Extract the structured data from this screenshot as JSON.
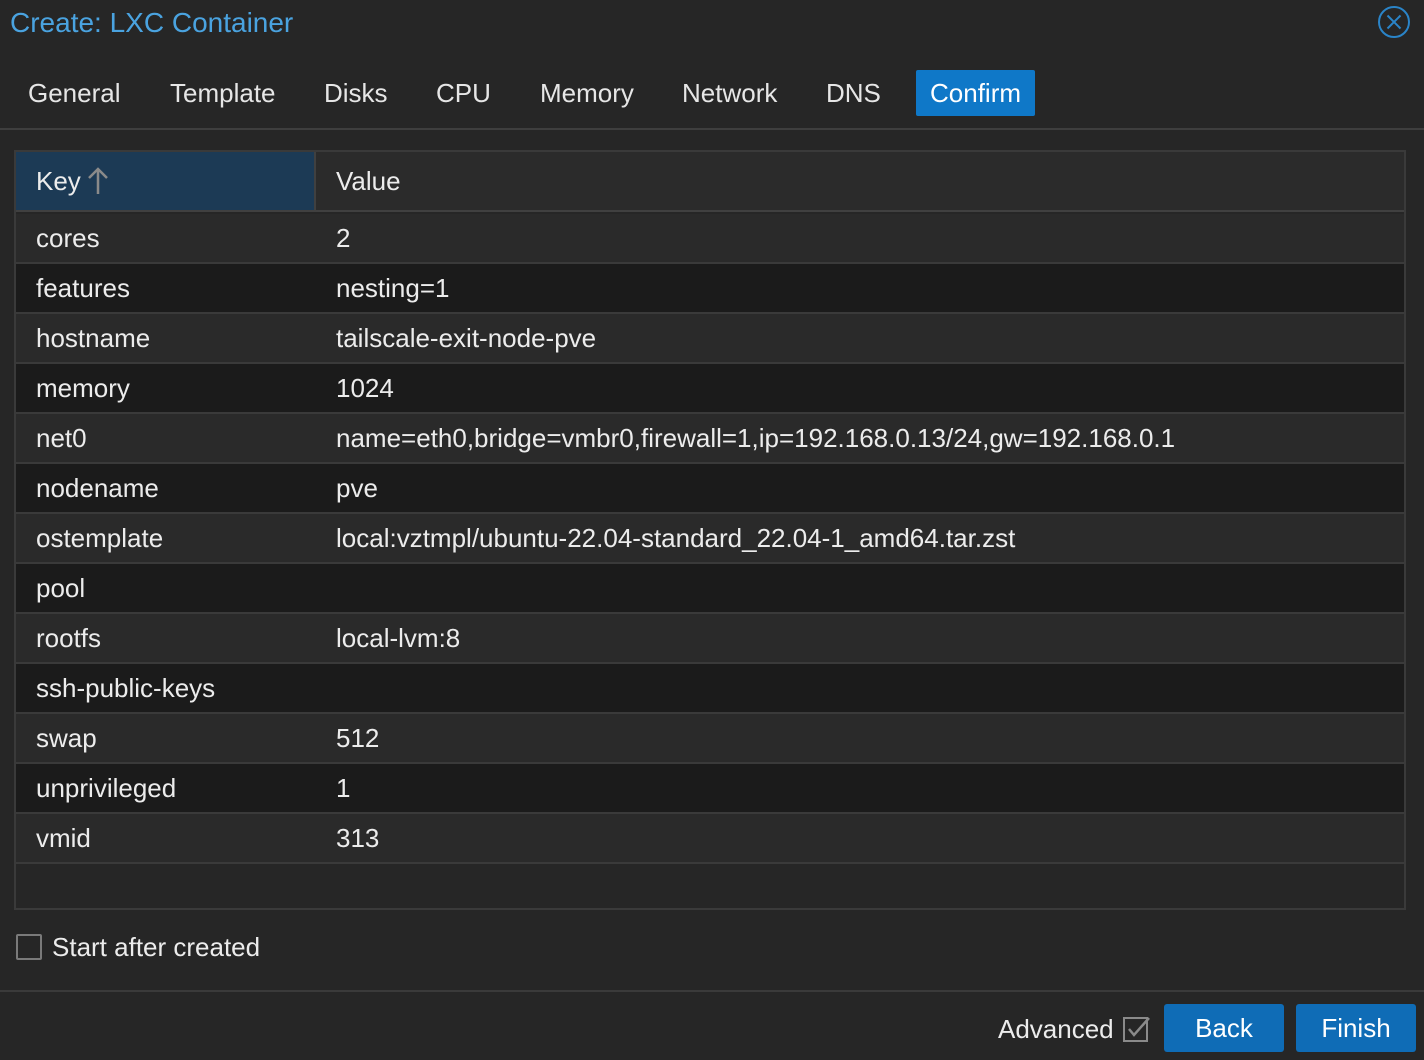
{
  "window": {
    "title": "Create: LXC Container"
  },
  "tabs": [
    {
      "label": "General",
      "active": false
    },
    {
      "label": "Template",
      "active": false
    },
    {
      "label": "Disks",
      "active": false
    },
    {
      "label": "CPU",
      "active": false
    },
    {
      "label": "Memory",
      "active": false
    },
    {
      "label": "Network",
      "active": false
    },
    {
      "label": "DNS",
      "active": false
    },
    {
      "label": "Confirm",
      "active": true
    }
  ],
  "grid": {
    "columns": {
      "key": "Key",
      "value": "Value",
      "sort": "ascending"
    },
    "rows": [
      {
        "key": "cores",
        "value": "2"
      },
      {
        "key": "features",
        "value": "nesting=1"
      },
      {
        "key": "hostname",
        "value": "tailscale-exit-node-pve"
      },
      {
        "key": "memory",
        "value": "1024"
      },
      {
        "key": "net0",
        "value": "name=eth0,bridge=vmbr0,firewall=1,ip=192.168.0.13/24,gw=192.168.0.1"
      },
      {
        "key": "nodename",
        "value": "pve"
      },
      {
        "key": "ostemplate",
        "value": "local:vztmpl/ubuntu-22.04-standard_22.04-1_amd64.tar.zst"
      },
      {
        "key": "pool",
        "value": ""
      },
      {
        "key": "rootfs",
        "value": "local-lvm:8"
      },
      {
        "key": "ssh-public-keys",
        "value": ""
      },
      {
        "key": "swap",
        "value": "512"
      },
      {
        "key": "unprivileged",
        "value": "1"
      },
      {
        "key": "vmid",
        "value": "313"
      }
    ]
  },
  "options": {
    "start_after_created_label": "Start after created",
    "start_after_created_checked": false
  },
  "footer": {
    "advanced_label": "Advanced",
    "advanced_checked": true,
    "back_label": "Back",
    "finish_label": "Finish"
  },
  "colors": {
    "accent": "#0f78c8",
    "title": "#4aa3e0",
    "background": "#262626",
    "header_sorted": "#1c3a55"
  },
  "icons": {
    "close": "close-circle-icon",
    "sort": "arrow-up-icon",
    "advanced_check": "checkbox-checked-icon"
  }
}
